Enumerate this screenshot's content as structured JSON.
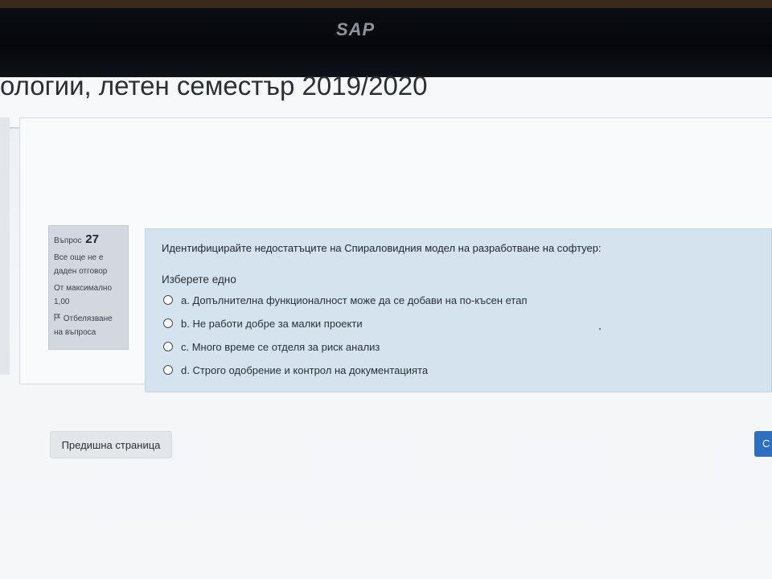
{
  "bezel": {
    "brand": "SAP"
  },
  "page": {
    "course_title": "ологии, летен семестър 2019/2020"
  },
  "question_info": {
    "number_label": "Въпрос",
    "number": "27",
    "status_line1": "Все още не е",
    "status_line2": "даден отговор",
    "max_label": "От максимално",
    "max_value": "1,00",
    "flag_line1": "Отбелязване",
    "flag_line2": "на въпроса"
  },
  "question": {
    "text": "Идентифицирайте недостатъците на Спираловидния модел на разработване на софтуер:",
    "prompt": "Изберете едно",
    "answers": [
      {
        "label": "a. Допълнителна функционалност може да се добави на по-късен етап"
      },
      {
        "label": "b. Не работи добре за малки проекти"
      },
      {
        "label": "c. Много време се отделя за риск анализ"
      },
      {
        "label": "d. Строго одобрение и контрол на документацията"
      }
    ]
  },
  "navigation": {
    "previous_label": "Предишна страница",
    "next_label": "С"
  }
}
